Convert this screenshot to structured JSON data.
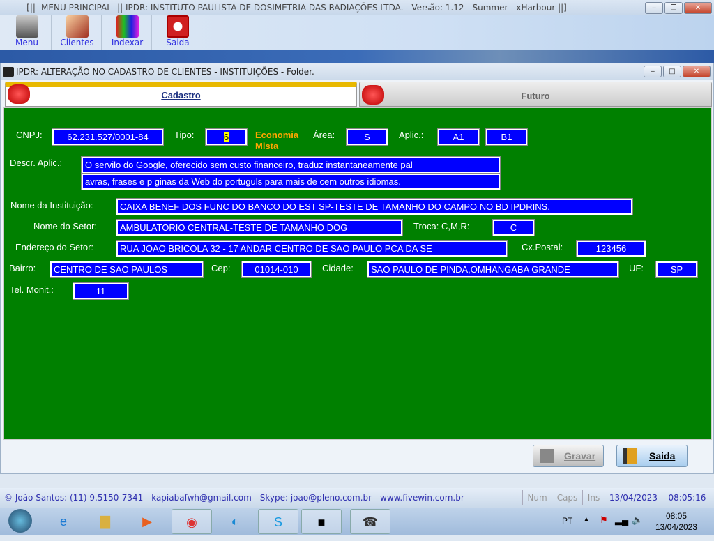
{
  "window": {
    "title": "- [||- MENU PRINCIPAL -|| IPDR: INSTITUTO PAULISTA DE DOSIMETRIA DAS RADIAÇÕES LTDA. - Versão: 1.12 - Summer - xHarbour ||]",
    "min": "‒",
    "max": "❐",
    "close": "✕"
  },
  "toolbar": [
    {
      "label": "Menu",
      "icon": "laptop-icon"
    },
    {
      "label": "Clientes",
      "icon": "face-icon"
    },
    {
      "label": "Indexar",
      "icon": "books-icon"
    },
    {
      "label": "Saida",
      "icon": "power-icon"
    }
  ],
  "child": {
    "title": "IPDR: ALTERAÇÃO NO CADASTRO DE CLIENTES - INSTITUIÇÕES - Folder.",
    "min": "‒",
    "max": "□",
    "close": "✕"
  },
  "tabs": [
    {
      "label": "Cadastro",
      "active": true
    },
    {
      "label": "Futuro",
      "active": false
    }
  ],
  "form": {
    "cnpj_label": "CNPJ:",
    "cnpj": "62.231.527/0001-84",
    "tipo_label": "Tipo:",
    "tipo": "6",
    "tipo_desc": "Economia Mista",
    "area_label": "Área:",
    "area": "S",
    "aplic_label": "Aplic.:",
    "aplic1": "A1",
    "aplic2": "B1",
    "descr_label": "Descr. Aplic.:",
    "descr1": "O servilo do Google, oferecido sem custo financeiro, traduz instantaneamente pal",
    "descr2": "avras, frases e p ginas da Web do portuguls para mais de cem outros idiomas.",
    "nome_label": "Nome da Instituição:",
    "nome": "CAIXA BENEF DOS FUNC DO BANCO DO EST SP-TESTE DE TAMANHO DO CAMPO NO BD IPDRINS.",
    "setor_label": "Nome do Setor:",
    "setor": "AMBULATORIO CENTRAL-TESTE DE TAMANHO DOG",
    "troca_label": "Troca: C,M,R:",
    "troca": "C",
    "end_label": "Endereço do Setor:",
    "end": "RUA JOAO BRICOLA 32 - 17 ANDAR CENTRO DE SAO PAULO PCA DA SE",
    "cx_label": "Cx.Postal:",
    "cx": "123456",
    "bairro_label": "Bairro:",
    "bairro": "CENTRO DE SAO PAULOS",
    "cep_label": "Cep:",
    "cep": "01014-010",
    "cidade_label": "Cidade:",
    "cidade": "SAO PAULO DE PINDA,OMHANGABA GRANDE",
    "uf_label": "UF:",
    "uf": "SP",
    "tel_label": "Tel. Monit.:",
    "tel": "11"
  },
  "buttons": {
    "gravar": "Gravar",
    "saida": "Saida"
  },
  "status": {
    "text": "© João Santos: (11) 9.5150-7341 - kapiabafwh@gmail.com - Skype: joao@pleno.com.br - www.fivewin.com.br",
    "num": "Num",
    "caps": "Caps",
    "ins": "Ins",
    "date": "13/04/2023",
    "time": "08:05:16"
  },
  "taskbar": {
    "lang": "PT",
    "clock_time": "08:05",
    "clock_date": "13/04/2023"
  },
  "colors": {
    "panel": "#008000",
    "field": "#0000ff",
    "accent_orange": "#ffa500"
  }
}
